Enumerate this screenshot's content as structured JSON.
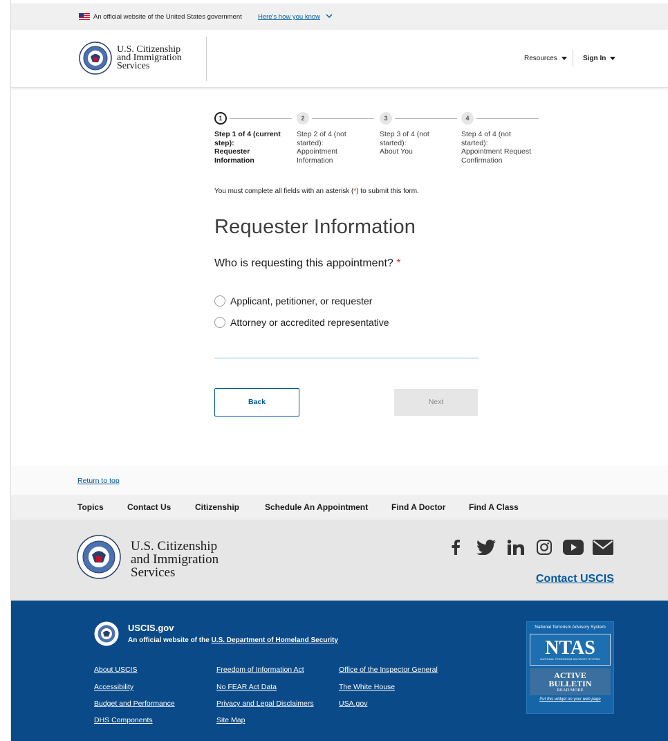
{
  "gov_banner": {
    "official_text": "An official website of the United States government",
    "how_you_know": "Here's how you know"
  },
  "header": {
    "brand_lines": [
      "U.S. Citizenship",
      "and Immigration",
      "Services"
    ],
    "resources_label": "Resources",
    "sign_in_label": "Sign In"
  },
  "stepper": [
    {
      "number": "1",
      "status": "current",
      "lines": [
        "Step 1 of 4 (current",
        "step):",
        "Requester",
        "Information"
      ]
    },
    {
      "number": "2",
      "status": "not-started",
      "lines": [
        "Step 2 of 4 (not",
        "started):",
        "Appointment",
        "Information"
      ]
    },
    {
      "number": "3",
      "status": "not-started",
      "lines": [
        "Step 3 of 4 (not",
        "started):",
        "About You"
      ]
    },
    {
      "number": "4",
      "status": "not-started",
      "lines": [
        "Step 4 of 4 (not",
        "started):",
        "Appointment Request",
        "Confirmation"
      ]
    }
  ],
  "form": {
    "required_note_pre": "You must complete all fields with an asterisk (",
    "required_note_ast": "*",
    "required_note_post": ") to submit this form.",
    "title": "Requester Information",
    "question": "Who is requesting this appointment?",
    "question_ast": "*",
    "options": [
      "Applicant, petitioner, or requester",
      "Attorney or accredited representative"
    ],
    "back_label": "Back",
    "next_label": "Next"
  },
  "footer": {
    "return_to_top": "Return to top",
    "nav": [
      "Topics",
      "Contact Us",
      "Citizenship",
      "Schedule An Appointment",
      "Find A Doctor",
      "Find A Class"
    ],
    "brand_lines": [
      "U.S. Citizenship",
      "and Immigration",
      "Services"
    ],
    "social_icons": [
      "facebook-icon",
      "twitter-icon",
      "linkedin-icon",
      "instagram-icon",
      "youtube-icon",
      "email-icon"
    ],
    "contact_label": "Contact USCIS",
    "gov_name": "USCIS.gov",
    "official_pre": "An official website of the ",
    "official_link": "U.S. Department of Homeland Security",
    "links_col1": [
      "About USCIS",
      "Accessibility",
      "Budget and Performance",
      "DHS Components"
    ],
    "links_col2": [
      "Freedom of Information Act",
      "No FEAR Act Data",
      "Privacy and Legal Disclaimers",
      "Site Map"
    ],
    "links_col3": [
      "Office of the Inspector General",
      "The White House",
      "USA.gov"
    ],
    "ntas": {
      "heading": "National Terrorism Advisory System",
      "logo_text": "NTAS",
      "logo_sub": "NATIONAL TERRORISM ADVISORY SYSTEM",
      "status_line1": "ACTIVE",
      "status_line2": "BULLETIN",
      "read_more": "READ MORE",
      "widget_link": "Put this widget on your web page"
    }
  },
  "colors": {
    "link_blue": "#00569d",
    "footer_dark": "#0b4a88",
    "required_red": "#d83933"
  }
}
